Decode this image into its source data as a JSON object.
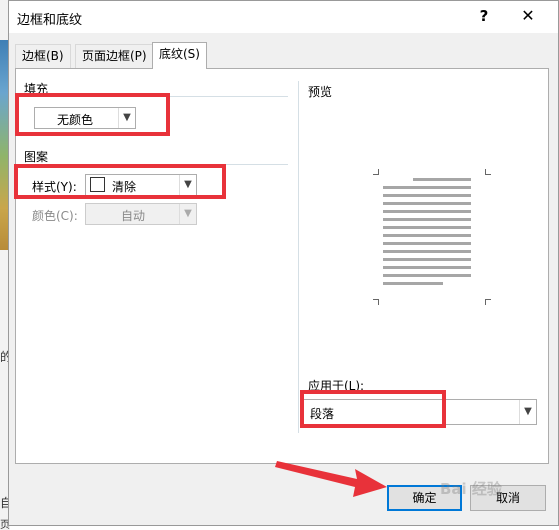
{
  "dialog": {
    "title": "边框和底纹",
    "help_glyph": "?",
    "close_glyph": "✕"
  },
  "tabs": [
    {
      "label": "边框(B)",
      "active": false
    },
    {
      "label": "页面边框(P)",
      "active": false
    },
    {
      "label": "底纹(S)",
      "active": true
    }
  ],
  "fill": {
    "group_label": "填充",
    "value": "无颜色"
  },
  "pattern": {
    "group_label": "图案",
    "style_label": "样式(Y):",
    "style_value": "清除",
    "color_label": "颜色(C):",
    "color_value": "自动"
  },
  "preview": {
    "group_label": "预览",
    "apply_label": "应用于(L):",
    "apply_value": "段落"
  },
  "buttons": {
    "ok": "确定",
    "cancel": "取消"
  },
  "background_fragments": [
    "自",
    "页",
    "的",
    "E"
  ],
  "watermark": "Bai 经验",
  "colors": {
    "highlight": "#e8323a",
    "default_button_border": "#0078d7"
  },
  "icons": {
    "dropdown": "chevron-down-icon",
    "close": "close-icon",
    "help": "help-icon"
  }
}
